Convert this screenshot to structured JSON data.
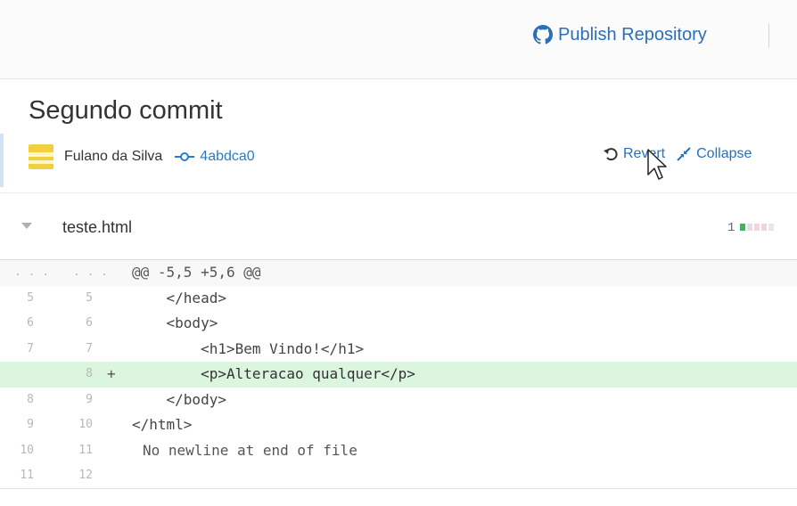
{
  "toolbar": {
    "publish_label": "Publish Repository",
    "publish_icon": "github-icon"
  },
  "commit": {
    "title": "Segundo commit",
    "author": "Fulano da Silva",
    "sha": "4abdca0",
    "revert_label": "Revert",
    "collapse_label": "Collapse"
  },
  "file": {
    "name": "teste.html",
    "count": "1",
    "stat_colors": [
      "#3cb85c",
      "#e0e0e0",
      "#f3d3dc",
      "#f3d3dc",
      "#e8e8e8"
    ]
  },
  "diff": {
    "hunk": "@@ -5,5 +5,6 @@",
    "lines": [
      {
        "old": "5",
        "new": "5",
        "sign": "",
        "text": "    </head>",
        "type": "context"
      },
      {
        "old": "6",
        "new": "6",
        "sign": "",
        "text": "    <body>",
        "type": "context"
      },
      {
        "old": "7",
        "new": "7",
        "sign": "",
        "text": "        <h1>Bem Vindo!</h1>",
        "type": "context"
      },
      {
        "old": "",
        "new": "8",
        "sign": "+",
        "text": "        <p>Alteracao qualquer</p>",
        "type": "add"
      },
      {
        "old": "8",
        "new": "9",
        "sign": "",
        "text": "    </body>",
        "type": "context"
      },
      {
        "old": "9",
        "new": "10",
        "sign": "",
        "text": "</html>",
        "type": "context"
      },
      {
        "old": "10",
        "new": "11",
        "sign": "",
        "text": "No newline at end of file",
        "type": "nonl"
      },
      {
        "old": "11",
        "new": "12",
        "sign": "",
        "text": "",
        "type": "context"
      }
    ]
  },
  "colors": {
    "accent": "#2a6fb8",
    "add_bg": "#dcf5df",
    "avatar": "#f0d040"
  }
}
